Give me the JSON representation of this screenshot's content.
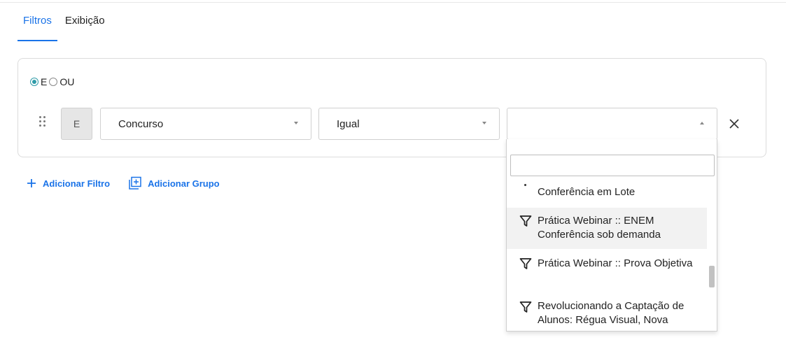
{
  "tabs": [
    {
      "label": "Filtros",
      "active": true
    },
    {
      "label": "Exibição",
      "active": false
    }
  ],
  "logic": {
    "options": [
      {
        "label": "E",
        "checked": true
      },
      {
        "label": "OU",
        "checked": false
      }
    ]
  },
  "filter_row": {
    "logic_label": "E",
    "field": {
      "value": "Concurso"
    },
    "operator": {
      "value": "Igual"
    },
    "value": {
      "value": "",
      "open": true
    }
  },
  "actions": {
    "add_filter": "Adicionar Filtro",
    "add_group": "Adicionar Grupo"
  },
  "dropdown": {
    "search_value": "",
    "items": [
      {
        "label": "Conferência em Lote",
        "partial": true
      },
      {
        "label": "Prática Webinar :: ENEM Conferência sob demanda",
        "highlighted": true
      },
      {
        "label": "Prática Webinar :: Prova Objetiva"
      },
      {
        "label": "Revolucionando a Captação de Alunos: Régua Visual, Nova"
      }
    ]
  },
  "colors": {
    "accent": "#1a73e8",
    "radio": "#2f9ba8"
  }
}
